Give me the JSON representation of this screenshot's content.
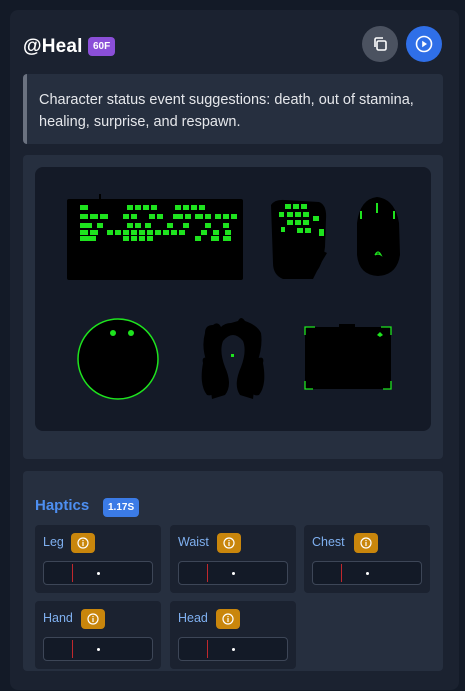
{
  "header": {
    "title": "@Heal",
    "badge": "60F"
  },
  "description": "Character status event suggestions: death, out of stamina, healing, surprise, and respawn.",
  "devices": [
    "keyboard",
    "keypad",
    "mouse",
    "mousepad-round",
    "headset",
    "mousepad-square"
  ],
  "haptics": {
    "title": "Haptics",
    "badge": "1.17S",
    "zones": [
      {
        "label": "Leg"
      },
      {
        "label": "Waist"
      },
      {
        "label": "Chest"
      },
      {
        "label": "Hand"
      },
      {
        "label": "Head"
      }
    ]
  },
  "colors": {
    "accent_green": "#1ee31e",
    "purple_badge": "#8b4fd8",
    "blue_badge": "#3b7be6",
    "info_orange": "#c9860c"
  }
}
